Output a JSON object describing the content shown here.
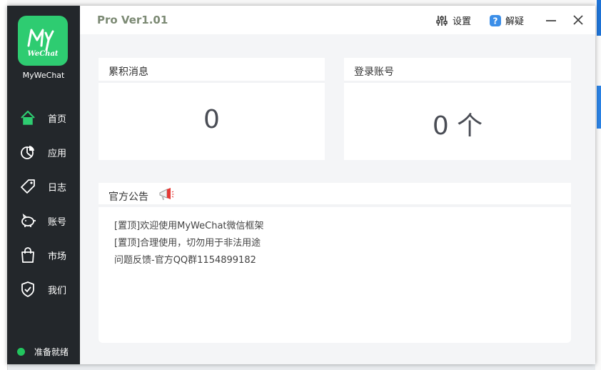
{
  "app": {
    "brand_name": "MyWeChat",
    "logo_text": "WeChat",
    "logo_initials": "My",
    "version": "Pro Ver1.01"
  },
  "toolbar": {
    "settings_label": "设置",
    "unlock_label": "解疑"
  },
  "sidebar": {
    "items": [
      {
        "label": "首页",
        "icon": "home-icon"
      },
      {
        "label": "应用",
        "icon": "pie-chart-icon"
      },
      {
        "label": "日志",
        "icon": "tag-icon"
      },
      {
        "label": "账号",
        "icon": "piggy-bank-icon"
      },
      {
        "label": "市场",
        "icon": "shopping-bag-icon"
      },
      {
        "label": "我们",
        "icon": "shield-check-icon"
      }
    ],
    "status": "准备就绪"
  },
  "stats": {
    "messages": {
      "title": "累积消息",
      "value": "0"
    },
    "accounts": {
      "title": "登录账号",
      "value": "0 个"
    }
  },
  "notice": {
    "title": "官方公告",
    "lines": [
      "[置顶]欢迎使用MyWeChat微信框架",
      "[置顶]合理使用，切勿用于非法用途",
      "问题反馈-官方QQ群1154899182"
    ]
  },
  "colors": {
    "sidebar_bg": "#23272b",
    "logo_green": "#2ecc71",
    "status_green": "#22c55e",
    "version_text": "#7c8a74"
  }
}
